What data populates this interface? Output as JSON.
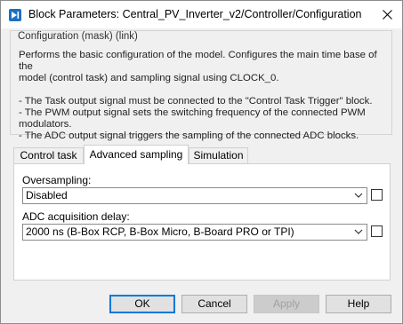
{
  "window": {
    "title": "Block Parameters: Central_PV_Inverter_v2/Controller/Configuration",
    "icon": "simulink-block-icon",
    "close_icon": "close-icon"
  },
  "mask": {
    "group_title": "Configuration (mask) (link)",
    "description_lines": [
      "Performs the basic configuration of the model. Configures the main time base of the",
      "model (control task) and sampling signal using CLOCK_0.",
      "",
      "- The Task output signal must be connected to the \"Control Task Trigger\" block.",
      "- The PWM output signal sets the switching frequency of the connected PWM",
      "modulators.",
      "- The ADC output signal triggers the sampling of the connected ADC blocks."
    ]
  },
  "tabs": [
    {
      "label": "Control task",
      "active": false
    },
    {
      "label": "Advanced sampling",
      "active": true
    },
    {
      "label": "Simulation",
      "active": false
    }
  ],
  "fields": {
    "oversampling": {
      "label": "Oversampling:",
      "value": "Disabled",
      "checked": false
    },
    "adc_delay": {
      "label": "ADC acquisition delay:",
      "value": "2000 ns (B-Box RCP, B-Box Micro, B-Board PRO or TPI)",
      "checked": false
    }
  },
  "buttons": {
    "ok": "OK",
    "cancel": "Cancel",
    "apply": "Apply",
    "help": "Help"
  },
  "colors": {
    "accent": "#0078d7",
    "icon_blue": "#1e6fc4",
    "window_bg": "#f0f0f0"
  }
}
